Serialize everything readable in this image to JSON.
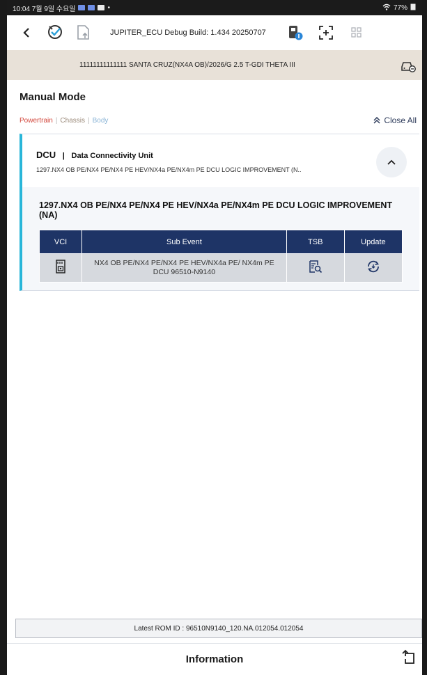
{
  "status_bar": {
    "left_text": "10:04  7월 9일 수요일",
    "right_text": "77%"
  },
  "app_bar": {
    "back_icon": "chevron-left-icon",
    "title": "JUPITER_ECU Debug Build: 1.434 20250707"
  },
  "vehicle": {
    "info": "11111111111111  SANTA CRUZ(NX4A OB)/2026/G 2.5 T-GDI THETA III"
  },
  "page": {
    "mode_title": "Manual Mode",
    "categories": [
      "Powertrain",
      "Chassis",
      "Body"
    ],
    "category_colors": [
      "#d2453a",
      "#9b8a7a",
      "#8ab4d6"
    ],
    "separator": "|",
    "close_all": "Close All"
  },
  "card": {
    "name": "DCU",
    "separator": "|",
    "full_name": "Data Connectivity Unit",
    "summary": "1297.NX4 OB PE/NX4 PE/NX4 PE HEV/NX4a PE/NX4m PE DCU LOGIC IMPROVEMENT (N..",
    "accent_color": "#29b6d9",
    "event_title": "1297.NX4 OB PE/NX4 PE/NX4 PE HEV/NX4a PE/NX4m PE DCU LOGIC IMPROVEMENT (NA)",
    "table": {
      "headers": [
        "VCI",
        "Sub Event",
        "TSB",
        "Update"
      ],
      "header_color": "#1e3466",
      "rows": [
        {
          "vci_icon": "sd-card-icon",
          "sub_event": "NX4 OB PE/NX4 PE/NX4 PE HEV/NX4a PE/ NX4m PE DCU 96510-N9140",
          "tsb_icon": "document-search-icon",
          "update_icon": "update-refresh-icon"
        }
      ]
    }
  },
  "rom": {
    "label": "Latest ROM ID : 96510N9140_120.NA.012054.012054"
  },
  "bottom": {
    "info_label": "Information"
  }
}
